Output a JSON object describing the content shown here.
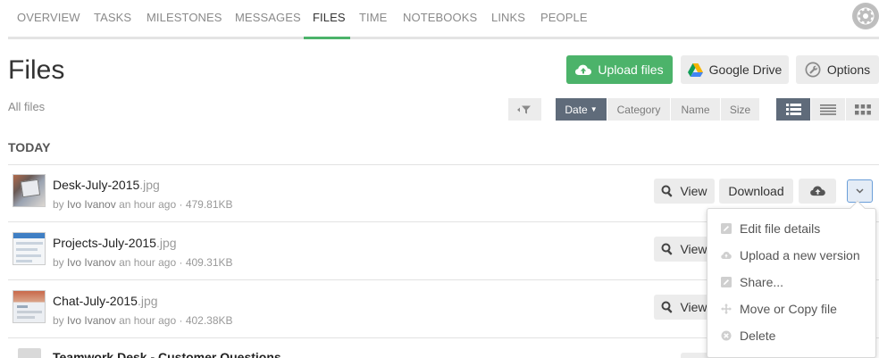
{
  "nav": {
    "tabs": [
      {
        "label": "OVERVIEW"
      },
      {
        "label": "TASKS"
      },
      {
        "label": "MILESTONES"
      },
      {
        "label": "MESSAGES"
      },
      {
        "label": "FILES"
      },
      {
        "label": "TIME"
      },
      {
        "label": "NOTEBOOKS"
      },
      {
        "label": "LINKS"
      },
      {
        "label": "PEOPLE"
      }
    ],
    "active_tab": "FILES"
  },
  "header": {
    "title": "Files",
    "subtitle": "All files",
    "upload_label": "Upload files",
    "google_drive_label": "Google Drive",
    "options_label": "Options"
  },
  "filters": {
    "sort_date": "Date",
    "sort_category": "Category",
    "sort_name": "Name",
    "sort_size": "Size"
  },
  "section": {
    "title": "TODAY"
  },
  "files": [
    {
      "name": "Desk-July-2015",
      "ext": ".jpg",
      "by": "by",
      "author": "Ivo Ivanov",
      "time": "an hour ago",
      "size": "479.81KB"
    },
    {
      "name": "Projects-July-2015",
      "ext": ".jpg",
      "by": "by",
      "author": "Ivo Ivanov",
      "time": "an hour ago",
      "size": "409.31KB"
    },
    {
      "name": "Chat-July-2015",
      "ext": ".jpg",
      "by": "by",
      "author": "Ivo Ivanov",
      "time": "an hour ago",
      "size": "402.38KB"
    },
    {
      "name": "Teamwork Desk - Customer Questions",
      "ext": "",
      "by": "",
      "author": "",
      "time": "",
      "size": ""
    }
  ],
  "row_actions": {
    "view_label": "View",
    "download_label": "Download"
  },
  "dropdown": {
    "items": [
      {
        "label": "Edit file details"
      },
      {
        "label": "Upload a new version"
      },
      {
        "label": "Share..."
      },
      {
        "label": "Move or Copy file"
      },
      {
        "label": "Delete"
      }
    ]
  },
  "colors": {
    "accent_green": "#4cb36a",
    "active_filter": "#5f6b7a",
    "button_grey": "#ececec",
    "dropdown_toggle_border": "#6a9ed8"
  },
  "icons": [
    "settings-gear-icon",
    "cloud-upload-icon",
    "google-drive-icon",
    "wrench-icon",
    "filter-icon",
    "caret-down-icon",
    "list-view-icon",
    "compact-list-icon",
    "grid-view-icon",
    "magnifier-icon",
    "chevron-down-icon",
    "pencil-icon",
    "cloud-icon",
    "share-icon",
    "move-icon",
    "delete-icon"
  ]
}
